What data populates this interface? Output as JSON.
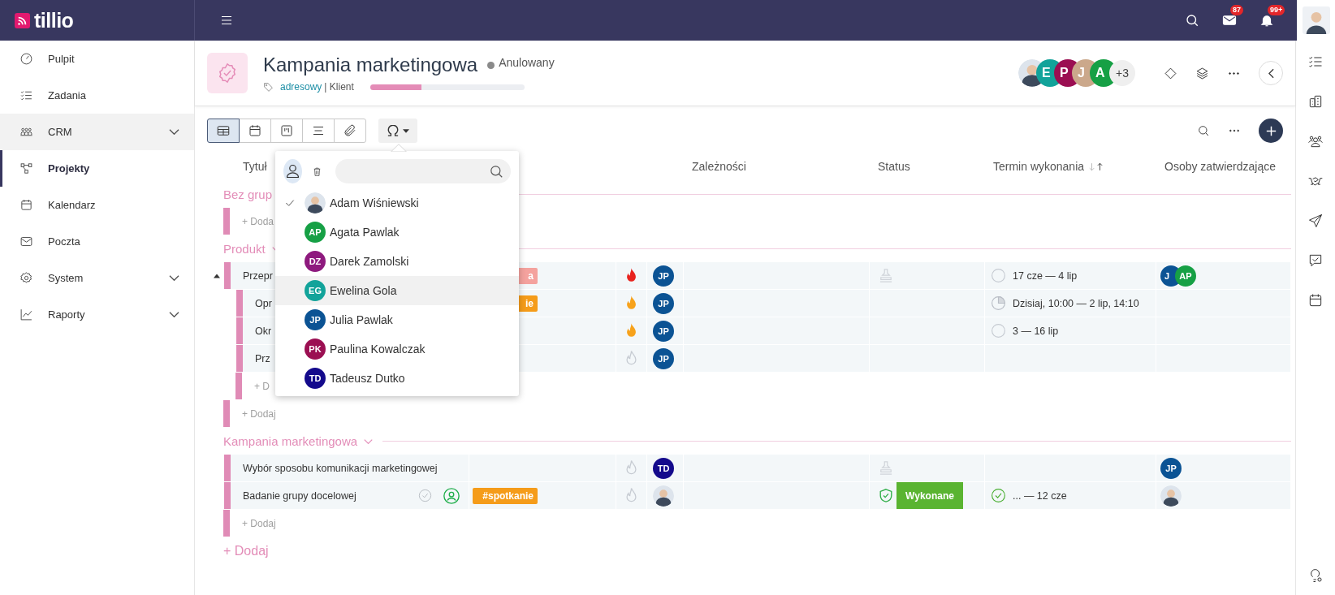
{
  "topbar": {
    "logo": "tillio",
    "mail_count": "87",
    "notification_count": "99+"
  },
  "sidebar": {
    "items": [
      {
        "label": "Pulpit",
        "selected": false,
        "highlighted": false,
        "expandable": false
      },
      {
        "label": "Zadania",
        "selected": false,
        "highlighted": false,
        "expandable": false
      },
      {
        "label": "CRM",
        "selected": false,
        "highlighted": true,
        "expandable": true
      },
      {
        "label": "Projekty",
        "selected": true,
        "highlighted": false,
        "expandable": false
      },
      {
        "label": "Kalendarz",
        "selected": false,
        "highlighted": false,
        "expandable": false
      },
      {
        "label": "Poczta",
        "selected": false,
        "highlighted": false,
        "expandable": false
      },
      {
        "label": "System",
        "selected": false,
        "highlighted": false,
        "expandable": true
      },
      {
        "label": "Raporty",
        "selected": false,
        "highlighted": false,
        "expandable": true
      }
    ]
  },
  "project": {
    "title": "Kampania marketingowa",
    "status": "Anulowany",
    "tag": "adresowy",
    "client": "| Klient",
    "progress": {
      "level": 0.33
    },
    "members": [
      {
        "kind": "photo"
      },
      {
        "kind": "initials",
        "initials": "E",
        "color": "#12a39a"
      },
      {
        "kind": "initials",
        "initials": "P",
        "color": "#9b0f52"
      },
      {
        "kind": "initials",
        "initials": "J",
        "color": "#cba88b"
      },
      {
        "kind": "initials",
        "initials": "A",
        "color": "#16a045"
      }
    ],
    "more_members": "+3"
  },
  "toolbar": {
    "views": [
      {
        "kind": "table",
        "selected": true
      },
      {
        "kind": "calendar",
        "selected": false
      },
      {
        "kind": "board",
        "selected": false
      },
      {
        "kind": "list",
        "selected": false
      },
      {
        "kind": "files",
        "selected": false
      }
    ]
  },
  "people_menu": {
    "person_filter": {
      "selected": true
    },
    "items": [
      {
        "name": "Adam Wiśniewski",
        "avatar": {
          "kind": "photo"
        },
        "checked": true,
        "highlighted": false
      },
      {
        "name": "Agata Pawlak",
        "avatar": {
          "kind": "initials",
          "initials": "AP",
          "color": "#16a045"
        },
        "checked": false,
        "highlighted": false
      },
      {
        "name": "Darek Zamolski",
        "avatar": {
          "kind": "initials",
          "initials": "DZ",
          "color": "#8e1a7e"
        },
        "checked": false,
        "highlighted": false
      },
      {
        "name": "Ewelina Gola",
        "avatar": {
          "kind": "initials",
          "initials": "EG",
          "color": "#12a39a"
        },
        "checked": false,
        "highlighted": true
      },
      {
        "name": "Julia Pawlak",
        "avatar": {
          "kind": "initials",
          "initials": "JP",
          "color": "#0b5394"
        },
        "checked": false,
        "highlighted": false
      },
      {
        "name": "Paulina Kowalczak",
        "avatar": {
          "kind": "initials",
          "initials": "PK",
          "color": "#9b0f52"
        },
        "checked": false,
        "highlighted": false
      },
      {
        "name": "Tadeusz Dutko",
        "avatar": {
          "kind": "initials",
          "initials": "TD",
          "color": "#140a8c"
        },
        "checked": false,
        "highlighted": false
      }
    ]
  },
  "table": {
    "columns": [
      {
        "label": "Tytuł"
      },
      {
        "label": "Zależności"
      },
      {
        "label": "Status"
      },
      {
        "label": "Termin wykonania",
        "ascending": true
      },
      {
        "label": "Osoby zatwierdzające"
      }
    ],
    "groups": [
      {
        "name": "Bez grup",
        "add": "+ Doda"
      },
      {
        "name": "Produkt",
        "expanded": true,
        "rows": [
          {
            "title": "Przepr",
            "expanded": true,
            "tag": {
              "label": "a",
              "color": "#f4a29e"
            },
            "priority": {
              "kind": "high"
            },
            "assignee": {
              "kind": "initials",
              "initials": "JP",
              "color": "#0b5394"
            },
            "approval": {
              "kind": "stamp"
            },
            "date": {
              "kind": "empty",
              "label": "17 cze — 4 lip"
            },
            "approvers": [
              {
                "kind": "initials",
                "initials": "J",
                "color": "#0b5394"
              },
              {
                "kind": "initials",
                "initials": "AP",
                "color": "#16a045"
              }
            ],
            "children": [
              {
                "title": "Opr",
                "tag": {
                  "label": "ie",
                  "color": "#f59c1a"
                },
                "priority": {
                  "kind": "medium"
                },
                "assignee": {
                  "kind": "initials",
                  "initials": "JP",
                  "color": "#0b5394"
                },
                "date": {
                  "kind": "quarter",
                  "label": "Dzisiaj, 10:00 — 2 lip, 14:10"
                }
              },
              {
                "title": "Okr",
                "priority": {
                  "kind": "medium"
                },
                "assignee": {
                  "kind": "initials",
                  "initials": "JP",
                  "color": "#0b5394"
                },
                "date": {
                  "kind": "empty",
                  "label": "3 — 16 lip"
                }
              },
              {
                "title": "Prz",
                "priority": {
                  "kind": "none"
                },
                "assignee": {
                  "kind": "initials",
                  "initials": "JP",
                  "color": "#0b5394"
                }
              }
            ],
            "add_child": "+ D"
          }
        ],
        "add": "+ Dodaj"
      },
      {
        "name": "Kampania marketingowa",
        "expanded": true,
        "rows": [
          {
            "title": "Wybór sposobu komunikacji marketingowej",
            "priority": {
              "kind": "none"
            },
            "assignee": {
              "kind": "initials",
              "initials": "TD",
              "color": "#140a8c"
            },
            "approval": {
              "kind": "stamp"
            },
            "approvers": [
              {
                "kind": "initials",
                "initials": "JP",
                "color": "#0b5394"
              }
            ]
          },
          {
            "title": "Badanie grupy docelowej",
            "completed": false,
            "watching": true,
            "tag": {
              "label": "#spotkanie",
              "color": "#f59c1a"
            },
            "priority": {
              "kind": "none"
            },
            "assignee": {
              "kind": "photo"
            },
            "approval": {
              "kind": "shield"
            },
            "status": {
              "label": "Wykonane",
              "color": "#5ab431"
            },
            "date": {
              "kind": "done",
              "label": "... — 12 cze"
            },
            "approvers": [
              {
                "kind": "photo"
              }
            ]
          }
        ],
        "add": "+ Dodaj"
      }
    ],
    "add_group": "+ Dodaj"
  }
}
